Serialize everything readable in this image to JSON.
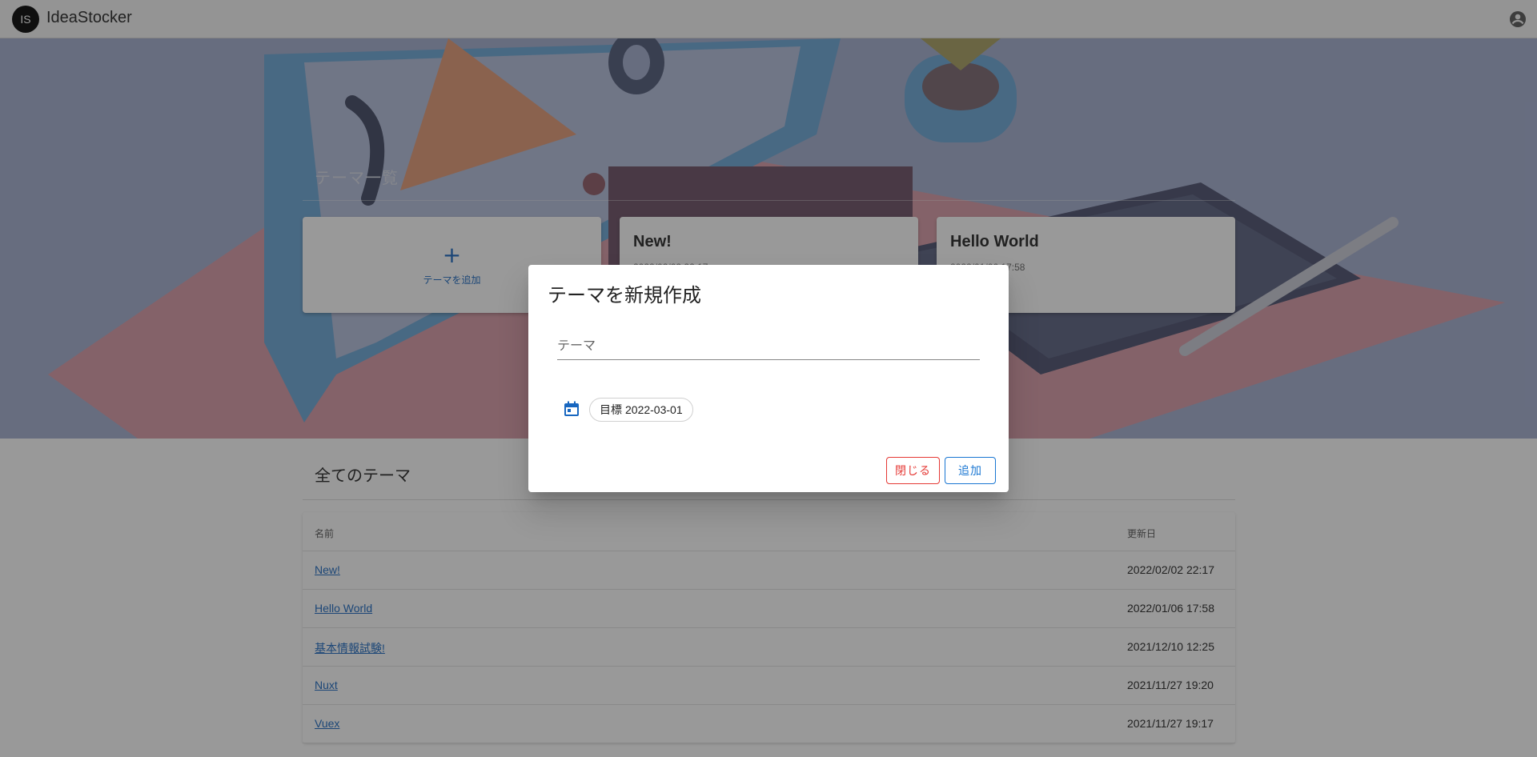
{
  "appbar": {
    "logo_initials": "IS",
    "title": "IdeaStocker",
    "account_icon": "account-circle-icon"
  },
  "hero": {
    "title": "テーマ一覧",
    "add_card": {
      "icon": "plus-icon",
      "label": "テーマを追加"
    },
    "cards": [
      {
        "title": "New!",
        "date": "2022/02/02 22:17"
      },
      {
        "title": "Hello World",
        "date": "2022/01/06 17:58"
      }
    ]
  },
  "all_themes": {
    "title": "全てのテーマ",
    "columns": [
      "名前",
      "更新日"
    ],
    "rows": [
      {
        "name": "New!",
        "updated": "2022/02/02 22:17"
      },
      {
        "name": "Hello World",
        "updated": "2022/01/06 17:58"
      },
      {
        "name": "基本情報試験!",
        "updated": "2021/12/10 12:25"
      },
      {
        "name": "Nuxt",
        "updated": "2021/11/27 19:20"
      },
      {
        "name": "Vuex",
        "updated": "2021/11/27 19:17"
      }
    ]
  },
  "dialog": {
    "title": "テーマを新規作成",
    "theme_field": {
      "placeholder": "テーマ",
      "value": ""
    },
    "calendar_icon": "calendar-icon",
    "goal_chip": {
      "label": "目標",
      "date": "2022-03-01"
    },
    "close_label": "閉じる",
    "add_label": "追加"
  },
  "colors": {
    "primary": "#1867c0",
    "danger": "#e53935",
    "appbar": "#f5f5f5"
  }
}
